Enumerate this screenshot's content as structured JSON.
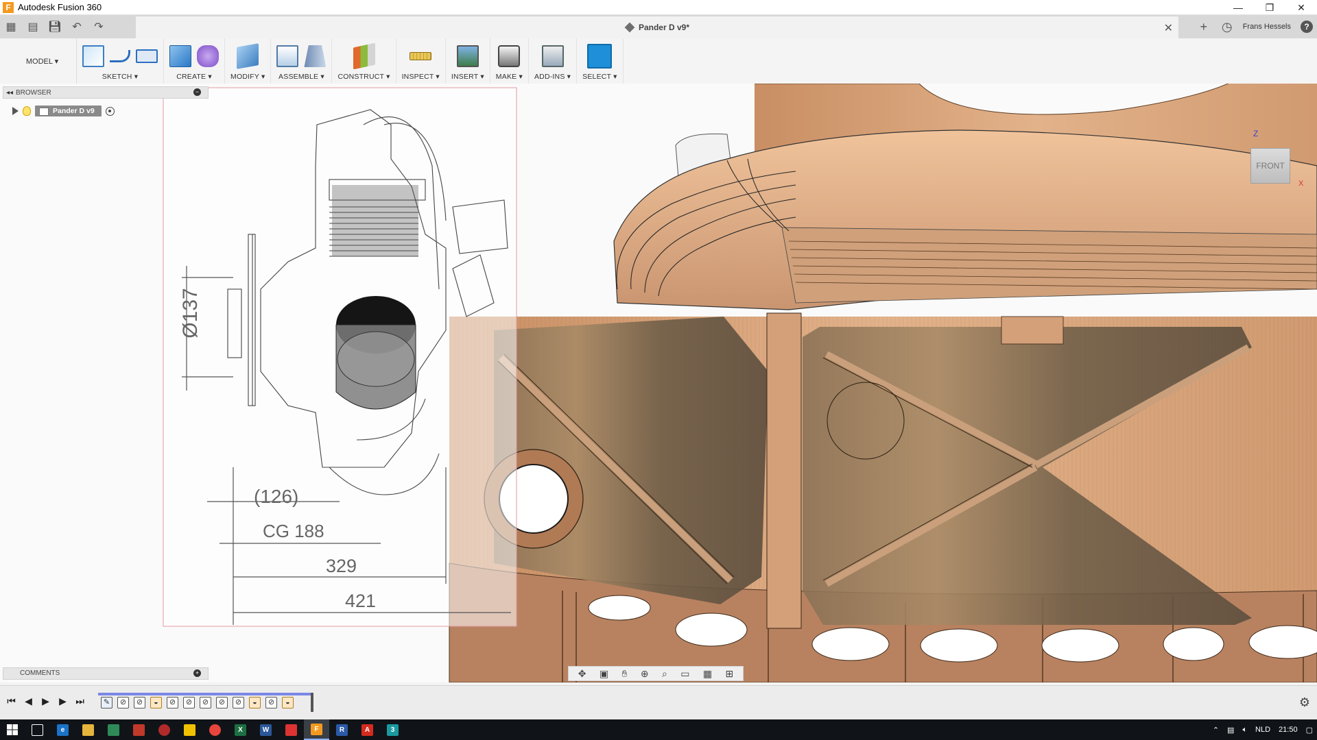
{
  "window": {
    "title": "Autodesk Fusion 360",
    "logo_letter": "F",
    "controls": [
      "—",
      "❐",
      "✕"
    ]
  },
  "tab": {
    "document_name": "Pander D v9*",
    "close": "✕"
  },
  "account": {
    "user_name": "Frans Hessels",
    "help": "?"
  },
  "ribbon": {
    "workspace": "MODEL ▾",
    "groups": [
      {
        "label": "SKETCH ▾"
      },
      {
        "label": "CREATE ▾"
      },
      {
        "label": "MODIFY ▾"
      },
      {
        "label": "ASSEMBLE ▾"
      },
      {
        "label": "CONSTRUCT ▾"
      },
      {
        "label": "INSPECT ▾"
      },
      {
        "label": "INSERT ▾"
      },
      {
        "label": "MAKE ▾"
      },
      {
        "label": "ADD-INS ▾"
      },
      {
        "label": "SELECT ▾"
      }
    ]
  },
  "browser": {
    "title": "BROWSER",
    "root_item": "Pander D v9"
  },
  "comments": {
    "title": "COMMENTS"
  },
  "viewcube": {
    "face": "FRONT",
    "axis_z": "Z",
    "axis_x": "X"
  },
  "drawing": {
    "dim_diameter": "Ø137",
    "dim_126": "(126)",
    "dim_cg": "CG 188",
    "dim_329": "329",
    "dim_421": "421"
  },
  "taskbar": {
    "language": "NLD",
    "time": "21:50"
  },
  "colors": {
    "wood_light": "#d9a77e",
    "wood_dark": "#7d6a52",
    "select_blue": "#1e8fd8",
    "timeline_blue": "#7a86e6"
  }
}
